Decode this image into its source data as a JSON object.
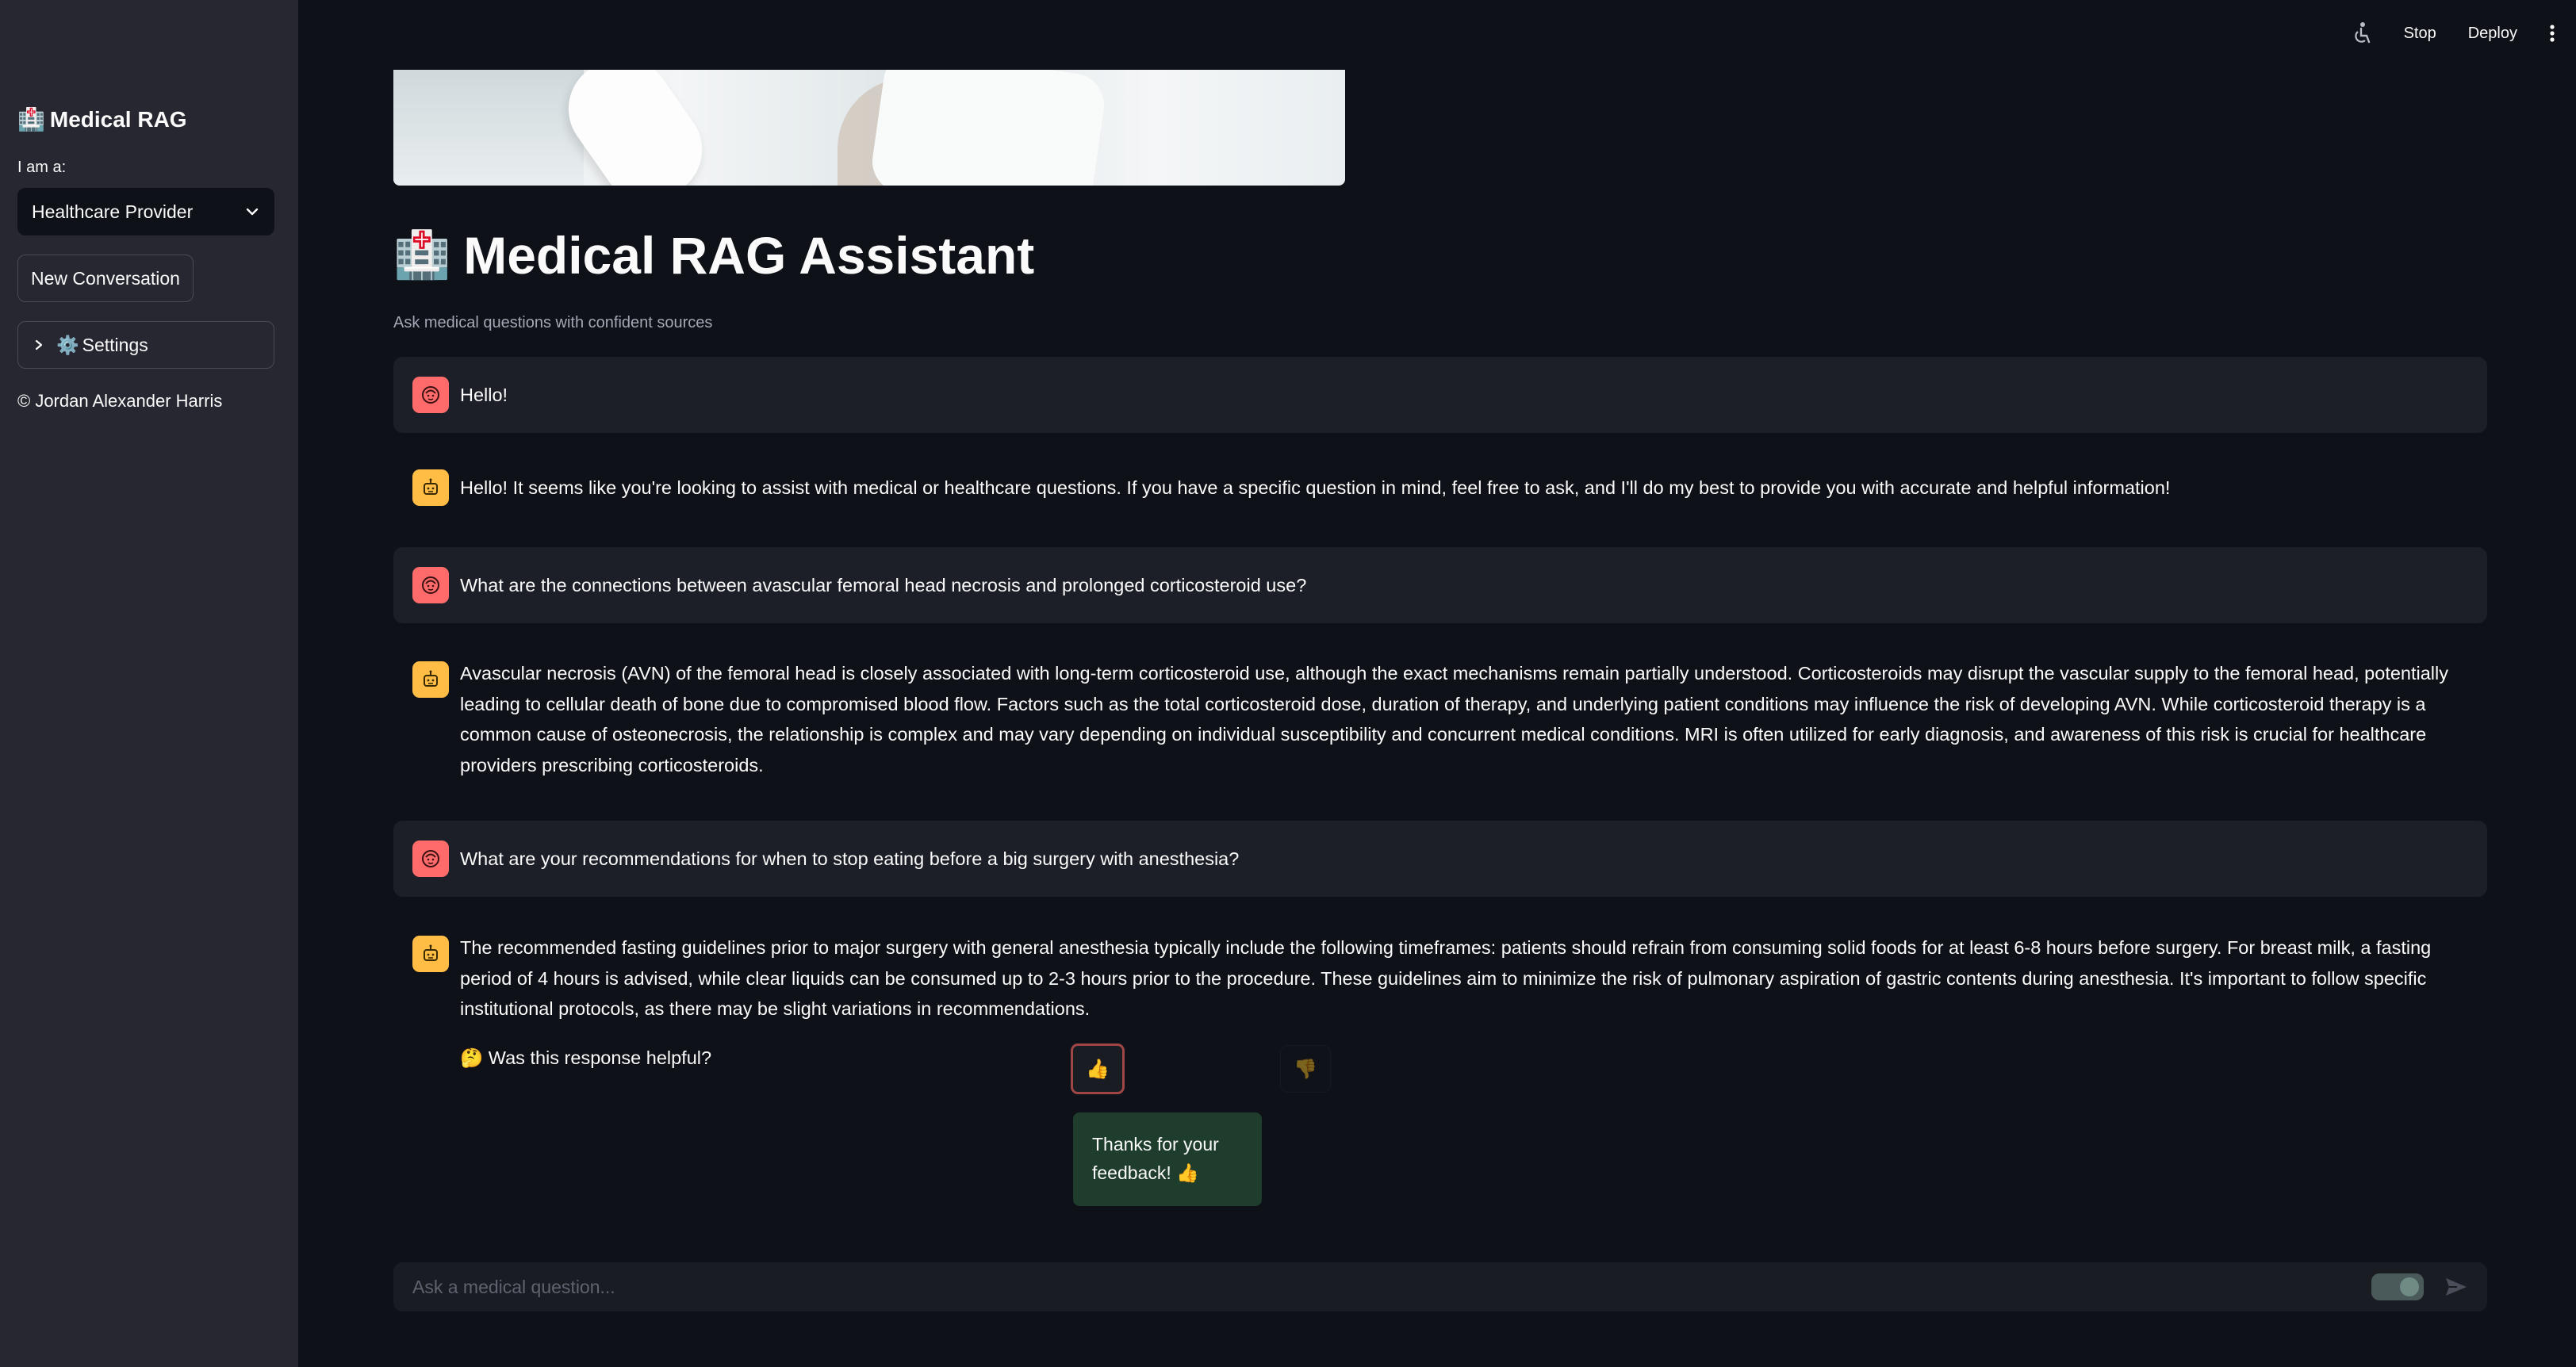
{
  "topbar": {
    "stop": "Stop",
    "deploy": "Deploy"
  },
  "sidebar": {
    "title_icon": "🏥",
    "title": "Medical RAG",
    "role_label": "I am a:",
    "role_value": "Healthcare Provider",
    "new_conversation": "New Conversation",
    "settings_icon": "⚙️",
    "settings_label": "Settings",
    "copyright": "© Jordan Alexander Harris"
  },
  "main": {
    "title_icon": "🏥",
    "title": "Medical RAG Assistant",
    "subtitle": "Ask medical questions with confident sources"
  },
  "messages": [
    {
      "role": "user",
      "text": "Hello!"
    },
    {
      "role": "assistant",
      "text": "Hello! It seems like you're looking to assist with medical or healthcare questions. If you have a specific question in mind, feel free to ask, and I'll do my best to provide you with accurate and helpful information!"
    },
    {
      "role": "user",
      "text": "What are the connections between avascular femoral head necrosis and prolonged corticosteroid use?"
    },
    {
      "role": "assistant",
      "text": "Avascular necrosis (AVN) of the femoral head is closely associated with long-term corticosteroid use, although the exact mechanisms remain partially understood. Corticosteroids may disrupt the vascular supply to the femoral head, potentially leading to cellular death of bone due to compromised blood flow. Factors such as the total corticosteroid dose, duration of therapy, and underlying patient conditions may influence the risk of developing AVN. While corticosteroid therapy is a common cause of osteonecrosis, the relationship is complex and may vary depending on individual susceptibility and concurrent medical conditions. MRI is often utilized for early diagnosis, and awareness of this risk is crucial for healthcare providers prescribing corticosteroids."
    },
    {
      "role": "user",
      "text": "What are your recommendations for when to stop eating before a big surgery with anesthesia?"
    },
    {
      "role": "assistant",
      "text": "The recommended fasting guidelines prior to major surgery with general anesthesia typically include the following timeframes: patients should refrain from consuming solid foods for at least 6-8 hours before surgery. For breast milk, a fasting period of 4 hours is advised, while clear liquids can be consumed up to 2-3 hours prior to the procedure. These guidelines aim to minimize the risk of pulmonary aspiration of gastric contents during anesthesia. It's important to follow specific institutional protocols, as there may be slight variations in recommendations."
    }
  ],
  "feedback": {
    "question": "🤔 Was this response helpful?",
    "thumbs_up": "👍",
    "thumbs_down": "👎",
    "toast": "Thanks for your feedback! 👍"
  },
  "chat_input": {
    "placeholder": "Ask a medical question..."
  }
}
